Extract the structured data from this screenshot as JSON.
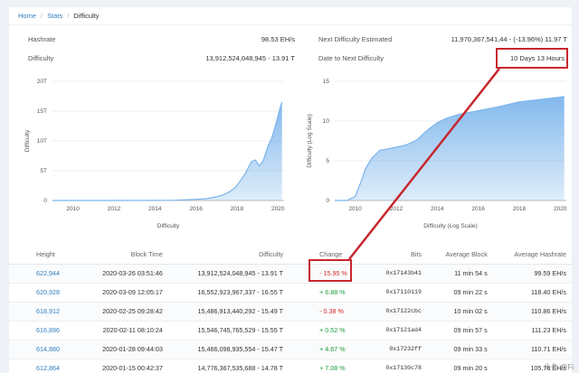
{
  "breadcrumb": {
    "home": "Home",
    "stats": "Stats",
    "current": "Difficulty"
  },
  "stats": {
    "hashrate_label": "Hashrate",
    "hashrate_value": "98.53 EH/s",
    "difficulty_label": "Difficulty",
    "difficulty_value": "13,912,524,048,945 - 13.91 T",
    "next_label": "Next Difficulty Estimated",
    "next_value_main": "11,970,367,541,44",
    "next_value_tail": " - (-13.96%) 11.97 T",
    "date_label": "Date to Next Difficulty",
    "date_value": "10 Days 13 Hours"
  },
  "chart_data": [
    {
      "type": "area",
      "title": "",
      "xlabel": "Difficulty",
      "ylabel": "Difficulty",
      "x_ticks": [
        "2010",
        "2012",
        "2014",
        "2016",
        "2018",
        "2020"
      ],
      "y_ticks": [
        "0",
        "5T",
        "10T",
        "15T",
        "20T"
      ],
      "xlim": [
        2009,
        2020.3
      ],
      "ylim": [
        0,
        20
      ],
      "y_unit": "T",
      "x": [
        2009,
        2012,
        2014,
        2015,
        2016,
        2016.5,
        2017,
        2017.3,
        2017.6,
        2017.9,
        2018.1,
        2018.4,
        2018.7,
        2018.9,
        2019.1,
        2019.3,
        2019.5,
        2019.7,
        2019.9,
        2020.1,
        2020.2
      ],
      "values": [
        0,
        0,
        0.03,
        0.05,
        0.2,
        0.3,
        0.6,
        0.9,
        1.4,
        2.1,
        3.0,
        4.5,
        6.5,
        6.8,
        5.8,
        6.8,
        9.0,
        10.5,
        12.8,
        15.5,
        16.5
      ],
      "color": "#7cb5ec"
    },
    {
      "type": "area",
      "title": "",
      "xlabel": "Difficulty (Log Scale)",
      "ylabel": "Difficulty (Log Scale)",
      "log_scale": true,
      "x_ticks": [
        "2010",
        "2012",
        "2014",
        "2016",
        "2018",
        "2020"
      ],
      "y_ticks": [
        "0",
        "5",
        "10",
        "15"
      ],
      "xlim": [
        2009,
        2020.3
      ],
      "ylim": [
        0,
        15
      ],
      "x": [
        2009,
        2009.6,
        2010,
        2010.3,
        2010.5,
        2010.8,
        2011.2,
        2011.6,
        2012,
        2012.5,
        2013,
        2013.5,
        2014,
        2014.5,
        2015,
        2016,
        2017,
        2018,
        2019,
        2020,
        2020.2
      ],
      "values": [
        0,
        0,
        0.5,
        2.5,
        4.0,
        5.3,
        6.3,
        6.5,
        6.7,
        7.0,
        7.6,
        8.8,
        9.8,
        10.4,
        10.8,
        11.3,
        11.8,
        12.4,
        12.7,
        13.0,
        13.1
      ],
      "color": "#7cb5ec"
    }
  ],
  "table": {
    "headers": [
      "Height",
      "Block Time",
      "Difficulty",
      "Change",
      "Bits",
      "Average Block",
      "Average Hashrate"
    ],
    "rows": [
      {
        "height": "622,944",
        "time": "2020-03-26 03:51:46",
        "difficulty": "13,912,524,048,945 - 13.91 T",
        "change": "- 15.95 %",
        "bits": "0x17143b41",
        "avg_block": "11 min 54 s",
        "avg_hashrate": "99.59 EH/s"
      },
      {
        "height": "620,928",
        "time": "2020-03-09 12:05:17",
        "difficulty": "16,552,923,967,337 - 16.55 T",
        "change": "+ 6.88 %",
        "bits": "0x17110119",
        "avg_block": "09 min 22 s",
        "avg_hashrate": "118.40 EH/s"
      },
      {
        "height": "618,912",
        "time": "2020-02-25 09:28:42",
        "difficulty": "15,486,913,440,292 - 15.49 T",
        "change": "- 0.38 %",
        "bits": "0x17122cbc",
        "avg_block": "10 min 02 s",
        "avg_hashrate": "110.86 EH/s"
      },
      {
        "height": "616,896",
        "time": "2020-02-11 08:10:24",
        "difficulty": "15,546,745,765,529 - 15.55 T",
        "change": "+ 0.52 %",
        "bits": "0x17121ad4",
        "avg_block": "09 min 57 s",
        "avg_hashrate": "111.23 EH/s"
      },
      {
        "height": "614,880",
        "time": "2020-01-28 09:44:03",
        "difficulty": "15,466,098,935,554 - 15.47 T",
        "change": "+ 4.67 %",
        "bits": "0x17232ff",
        "avg_block": "09 min 33 s",
        "avg_hashrate": "110.71 EH/s"
      },
      {
        "height": "612,864",
        "time": "2020-01-15 00:42:37",
        "difficulty": "14,776,367,535,688 - 14.78 T",
        "change": "+ 7.08 %",
        "bits": "0x17130c78",
        "avg_block": "09 min 20 s",
        "avg_hashrate": "105.76 EH/s"
      }
    ]
  },
  "watermark": "头条 @Fi"
}
